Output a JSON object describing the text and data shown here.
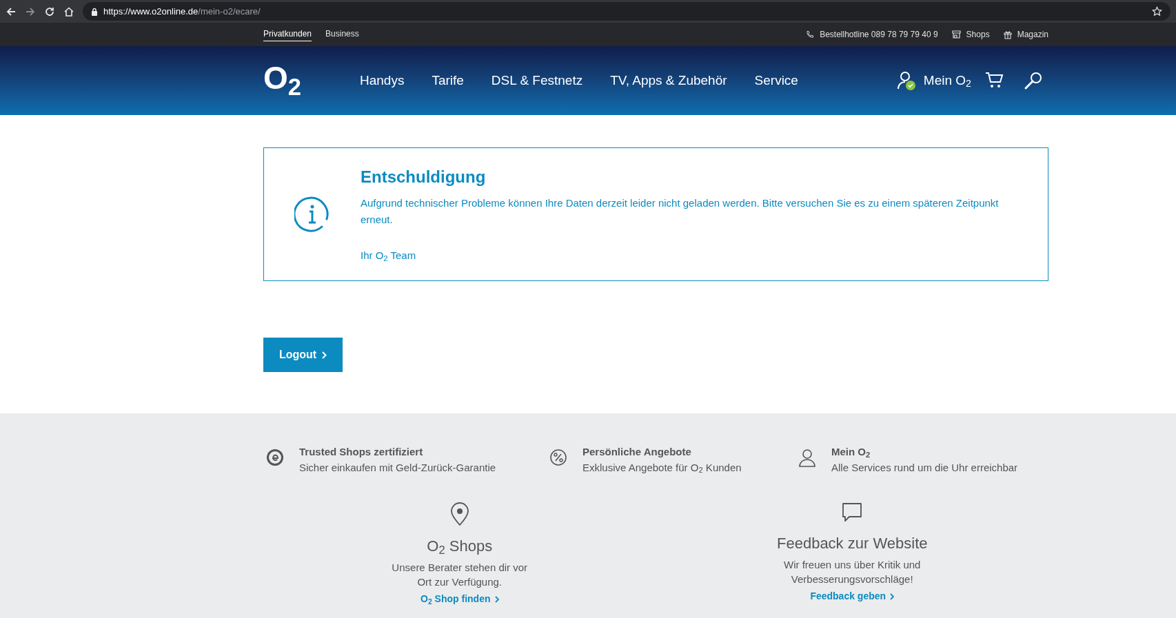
{
  "browser": {
    "url_host": "https://www.o2online.de",
    "url_path": "/mein-o2/ecare/"
  },
  "top_bar": {
    "segments": [
      {
        "label": "Privatkunden",
        "selected": true
      },
      {
        "label": "Business",
        "selected": false
      }
    ],
    "links": [
      {
        "kind": "phone",
        "label": "Bestellhotline 089 78 79 79 40 9"
      },
      {
        "kind": "shop",
        "label": "Shops"
      },
      {
        "kind": "magazine",
        "label": "Magazin"
      }
    ]
  },
  "header": {
    "logo": "O$_{2}$",
    "nav": [
      "Handys",
      "Tarife",
      "DSL & Festnetz",
      "TV, Apps & Zubehör",
      "Service"
    ],
    "account": {
      "label": "Mein O$_{2}$",
      "logged_in": true
    }
  },
  "notice": {
    "title": "Entschuldigung",
    "message": "Aufgrund technischer Probleme können Ihre Daten derzeit leider nicht geladen werden. Bitte versuchen Sie es zu einem späteren Zeitpunkt erneut.",
    "signature": "Ihr O$_{2}$ Team"
  },
  "logout_button": "Logout",
  "footer": {
    "features": [
      {
        "kind": "trusted",
        "title": "Trusted Shops zertifiziert",
        "text": "Sicher einkaufen mit Geld-Zurück-Garantie"
      },
      {
        "kind": "percent",
        "title": "Persönliche Angebote",
        "text": "Exklusive Angebote für O$_{2}$ Kunden"
      },
      {
        "kind": "person",
        "title": "Mein O$_{2}$",
        "text": "Alle Services rund um die Uhr erreichbar"
      }
    ],
    "blocks": [
      {
        "kind": "pin",
        "title": "O$_{2}$ Shops",
        "lines": [
          "Unsere Berater stehen dir vor",
          "Ort zur Verfügung."
        ],
        "link": "O$_{2}$ Shop finden"
      },
      {
        "kind": "chat",
        "title": "Feedback zur Website",
        "lines": [
          "Wir freuen uns über Kritik und",
          "Verbesserungsvorschläge!"
        ],
        "link": "Feedback geben"
      }
    ]
  }
}
